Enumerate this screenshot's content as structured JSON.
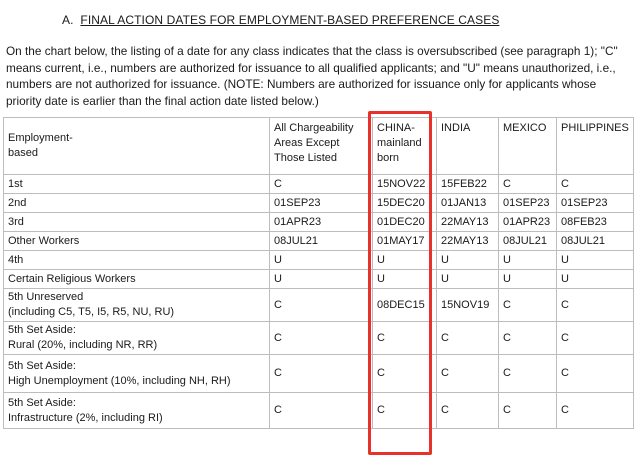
{
  "section": {
    "prefix": "A.",
    "title": "FINAL ACTION DATES FOR EMPLOYMENT-BASED PREFERENCE CASES"
  },
  "intro": "On the chart below, the listing of a date for any class indicates that the class is oversubscribed (see paragraph 1); \"C\" means current, i.e., numbers are authorized for issuance to all qualified applicants; and \"U\" means unauthorized, i.e., numbers are not authorized for issuance. (NOTE: Numbers are authorized for issuance only for applicants whose priority date is earlier than the final action date listed below.)",
  "table": {
    "headers": [
      "Employment-\nbased",
      "All Chargeability\nAreas Except\nThose Listed",
      "CHINA-\nmainland\nborn",
      "INDIA",
      "MEXICO",
      "PHILIPPINES"
    ],
    "rows": [
      {
        "category": "1st",
        "values": [
          "C",
          "15NOV22",
          "15FEB22",
          "C",
          "C"
        ]
      },
      {
        "category": "2nd",
        "values": [
          "01SEP23",
          "15DEC20",
          "01JAN13",
          "01SEP23",
          "01SEP23"
        ]
      },
      {
        "category": "3rd",
        "values": [
          "01APR23",
          "01DEC20",
          "22MAY13",
          "01APR23",
          "08FEB23"
        ]
      },
      {
        "category": "Other Workers",
        "values": [
          "08JUL21",
          "01MAY17",
          "22MAY13",
          "08JUL21",
          "08JUL21"
        ]
      },
      {
        "category": "4th",
        "values": [
          "U",
          "U",
          "U",
          "U",
          "U"
        ]
      },
      {
        "category": "Certain Religious Workers",
        "values": [
          "U",
          "U",
          "U",
          "U",
          "U"
        ]
      },
      {
        "category": "5th Unreserved\n(including C5, T5, I5, R5, NU, RU)",
        "values": [
          "C",
          "08DEC15",
          "15NOV19",
          "C",
          "C"
        ]
      },
      {
        "category": "5th Set Aside:\nRural (20%, including NR, RR)",
        "values": [
          "C",
          "C",
          "C",
          "C",
          "C"
        ]
      },
      {
        "category": "5th Set Aside:\nHigh Unemployment (10%, including NH, RH)",
        "values": [
          "C",
          "C",
          "C",
          "C",
          "C"
        ]
      },
      {
        "category": "5th Set Aside:\nInfrastructure (2%, including RI)",
        "values": [
          "C",
          "C",
          "C",
          "C",
          "C"
        ]
      }
    ]
  },
  "highlight_color": "#e8312a"
}
